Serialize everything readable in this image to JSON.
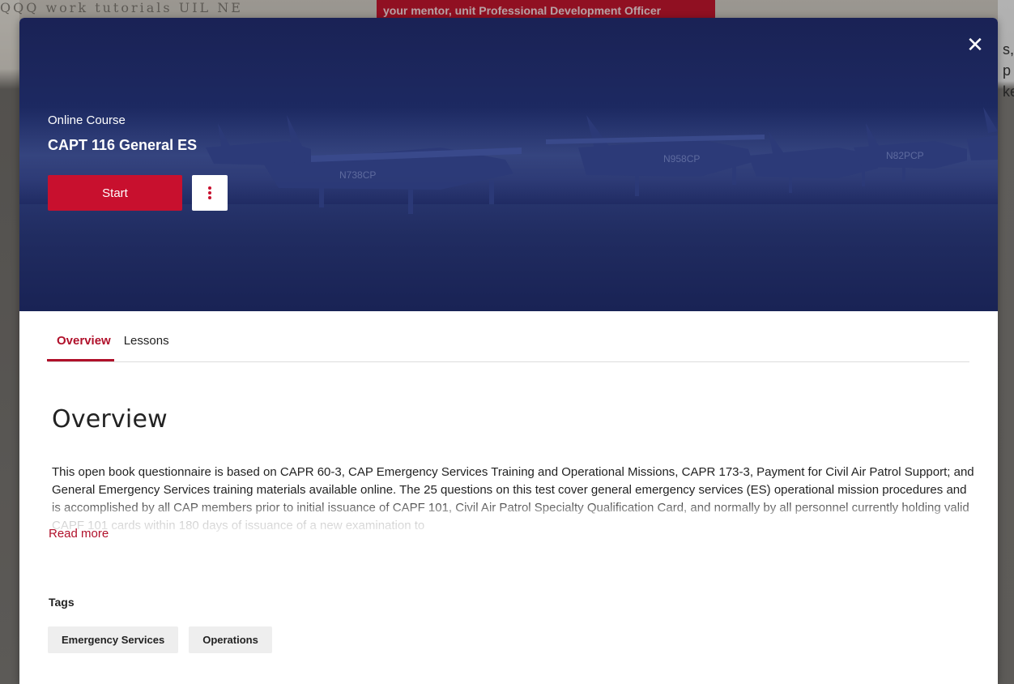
{
  "background": {
    "banner_text": "your mentor, unit Professional Development Officer",
    "sketch_text": "QQQ  work tutorials  UIL   NE",
    "right_edge_text": [
      "s, p",
      "ke"
    ]
  },
  "modal": {
    "close_icon": "close-icon",
    "hero": {
      "course_type": "Online Course",
      "course_title": "CAPT 116 General ES",
      "start_label": "Start",
      "more_icon": "more-vertical-icon",
      "accent_color": "#c8102e",
      "overlay_color": "#1d2a63"
    },
    "tabs": [
      {
        "label": "Overview",
        "active": true
      },
      {
        "label": "Lessons",
        "active": false
      }
    ],
    "overview": {
      "heading": "Overview",
      "description": "This open book questionnaire is based on CAPR 60-3, CAP Emergency Services Training and Operational Missions, CAPR 173-3, Payment for Civil Air Patrol Support; and General Emergency Services training materials available online. The 25 questions on this test cover general emergency services (ES) operational mission procedures and is accomplished by all CAP members prior to initial issuance of CAPF 101, Civil Air Patrol Specialty Qualification Card, and normally by all personnel currently holding valid CAPF 101 cards within 180 days of issuance of a new examination to",
      "read_more": "Read more"
    },
    "tags": {
      "label": "Tags",
      "items": [
        "Emergency Services",
        "Operations"
      ]
    }
  }
}
